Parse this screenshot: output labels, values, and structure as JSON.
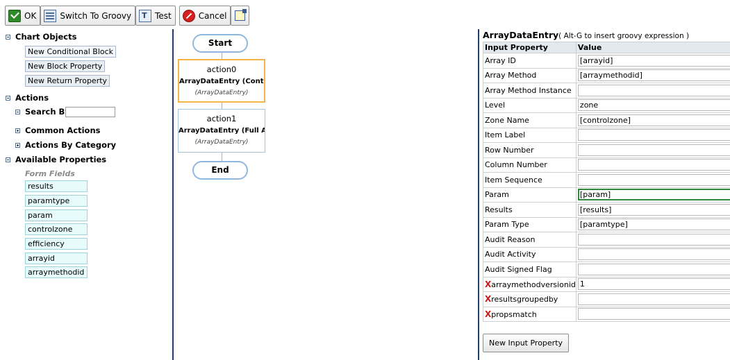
{
  "toolbar": {
    "ok_label": "OK",
    "groovy_label": "Switch To Groovy",
    "test_label": "Test",
    "cancel_label": "Cancel"
  },
  "left_panel": {
    "chart_objects_label": "Chart Objects",
    "chart_objects": [
      "New Conditional Block",
      "New Block Property",
      "New Return Property"
    ],
    "actions_label": "Actions",
    "search_label": "Search By:",
    "search_value": "",
    "common_actions_label": "Common Actions",
    "actions_by_category_label": "Actions By Category",
    "available_properties_label": "Available Properties",
    "form_fields_label": "Form Fields",
    "form_fields": [
      "results",
      "paramtype",
      "param",
      "controlzone",
      "efficiency",
      "arrayid",
      "arraymethodid"
    ]
  },
  "flow": {
    "start_label": "Start",
    "end_label": "End",
    "actions": [
      {
        "name": "action0",
        "title": "ArrayDataEntry (Contro",
        "subtitle": "(ArrayDataEntry)"
      },
      {
        "name": "action1",
        "title": "ArrayDataEntry (Full Ar",
        "subtitle": "(ArrayDataEntry)"
      }
    ]
  },
  "properties": {
    "title": "ArrayDataEntry",
    "hint": "( Alt-G to insert groovy expression )",
    "col_property": "Input Property",
    "col_value": "Value",
    "rows": [
      {
        "key": "Array ID",
        "value": "[arrayid]"
      },
      {
        "key": "Array Method",
        "value": "[arraymethodid]"
      },
      {
        "key": "Array Method Instance",
        "value": ""
      },
      {
        "key": "Level",
        "value": "zone"
      },
      {
        "key": "Zone Name",
        "value": "[controlzone]"
      },
      {
        "key": "Item Label",
        "value": ""
      },
      {
        "key": "Row Number",
        "value": ""
      },
      {
        "key": "Column Number",
        "value": ""
      },
      {
        "key": "Item Sequence",
        "value": ""
      },
      {
        "key": "Param",
        "value": "[param]"
      },
      {
        "key": "Results",
        "value": "[results]"
      },
      {
        "key": "Param Type",
        "value": "[paramtype]"
      },
      {
        "key": "Audit Reason",
        "value": ""
      },
      {
        "key": "Audit Activity",
        "value": ""
      },
      {
        "key": "Audit Signed Flag",
        "value": ""
      }
    ],
    "remove_marker": "X",
    "extra_rows": [
      {
        "key": "arraymethodversionid",
        "value": "1"
      },
      {
        "key": "resultsgroupedby",
        "value": ""
      },
      {
        "key": "propsmatch",
        "value": ""
      }
    ],
    "new_input_label": "New Input Property"
  }
}
